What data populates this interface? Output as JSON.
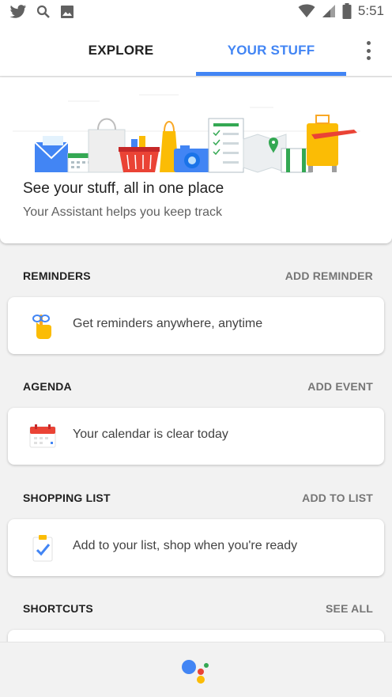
{
  "status_bar": {
    "left_icons": [
      "twitter-icon",
      "search-icon",
      "image-icon"
    ],
    "right_icons": [
      "wifi-icon",
      "signal-icon",
      "battery-icon"
    ],
    "time": "5:51"
  },
  "tabs": [
    {
      "label": "EXPLORE",
      "selected": false
    },
    {
      "label": "YOUR STUFF",
      "selected": true
    }
  ],
  "accent_color": "#4285f4",
  "hero": {
    "title": "See your stuff, all in one place",
    "subtitle": "Your Assistant helps you keep track"
  },
  "sections": [
    {
      "label": "REMINDERS",
      "action": "ADD REMINDER",
      "card_text": "Get reminders anywhere, anytime",
      "icon": "hand-string-reminder-icon"
    },
    {
      "label": "AGENDA",
      "action": "ADD EVENT",
      "card_text": "Your calendar is clear today",
      "icon": "calendar-icon"
    },
    {
      "label": "SHOPPING LIST",
      "action": "ADD TO LIST",
      "card_text": "Add to your list, shop when you're ready",
      "icon": "checklist-icon"
    },
    {
      "label": "SHORTCUTS",
      "action": "SEE ALL"
    }
  ],
  "bottom_bar": {
    "icon": "google-assistant-icon"
  }
}
